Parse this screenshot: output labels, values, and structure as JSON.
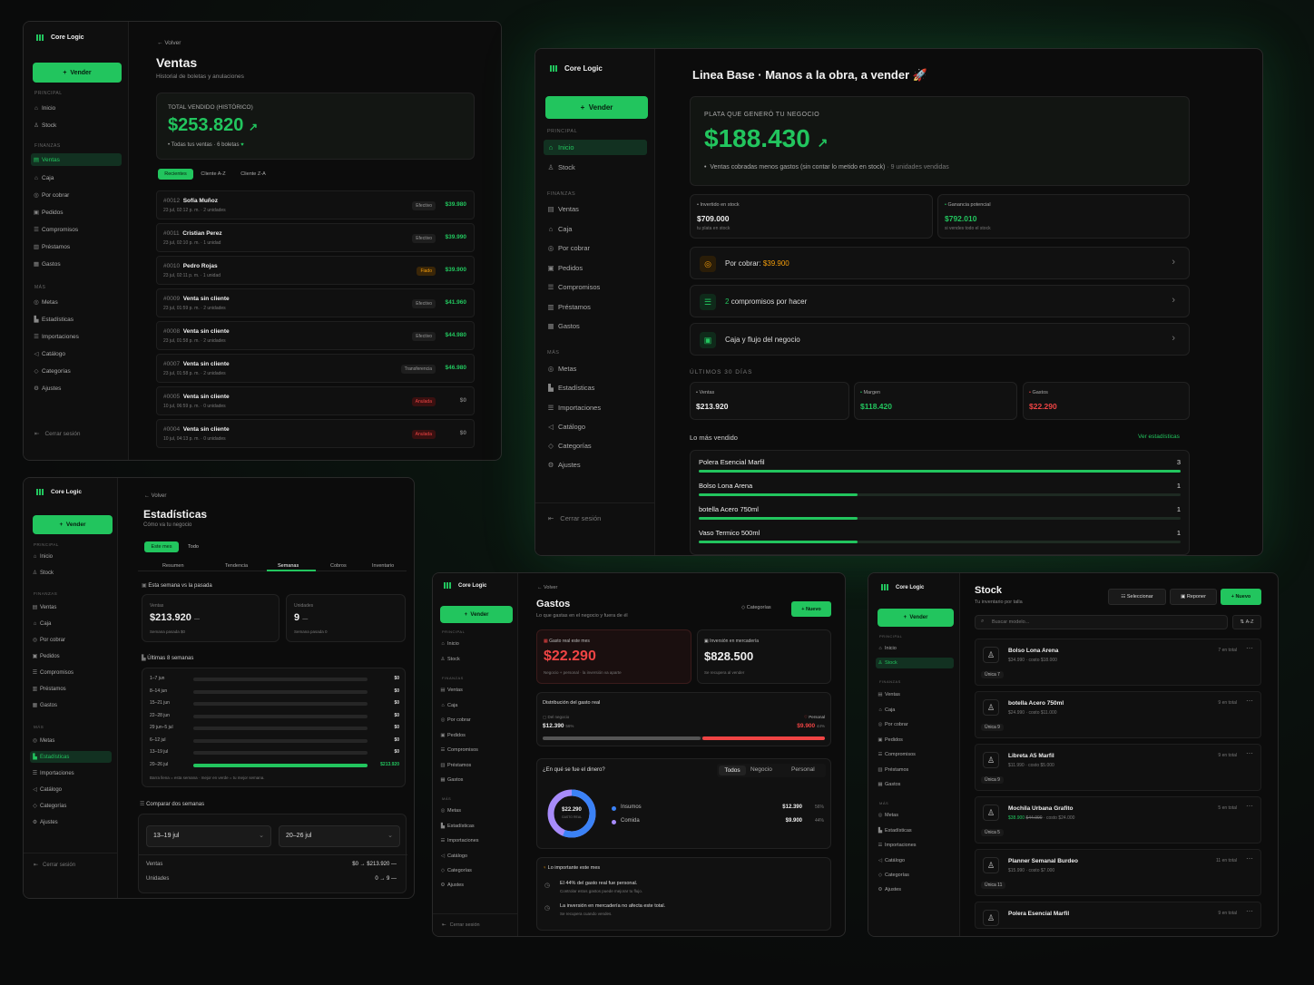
{
  "brand": "Core Logic",
  "vender": "Vender",
  "nav": {
    "principal": "PRINCIPAL",
    "inicio": "Inicio",
    "stock": "Stock",
    "finanzas": "FINANZAS",
    "ventas": "Ventas",
    "caja": "Caja",
    "por_cobrar": "Por cobrar",
    "pedidos": "Pedidos",
    "compromisos": "Compromisos",
    "prestamos": "Préstamos",
    "gastos": "Gastos",
    "mas": "MÁS",
    "metas": "Metas",
    "estadisticas": "Estadísticas",
    "importaciones": "Importaciones",
    "catalogo": "Catálogo",
    "categorias": "Categorías",
    "ajustes": "Ajustes",
    "logout": "Cerrar sesión"
  },
  "back": "Volver",
  "ventas": {
    "title": "Ventas",
    "subtitle": "Historial de boletas y anulaciones",
    "total_label": "TOTAL VENDIDO (HISTÓRICO)",
    "total": "$253.820",
    "total_note": "Todas tus ventas · 6 boletas",
    "filters": [
      "Recientes",
      "Cliente A-Z",
      "Cliente Z-A"
    ],
    "rows": [
      {
        "id": "#0012",
        "name": "Sofía Muñoz",
        "meta": "23 jul, 02:12 p. m. · 2 unidades",
        "tag": "Efectivo",
        "amount": "$39.980"
      },
      {
        "id": "#0011",
        "name": "Cristian Perez",
        "meta": "23 jul, 02:10 p. m. · 1 unidad",
        "tag": "Efectivo",
        "amount": "$39.990"
      },
      {
        "id": "#0010",
        "name": "Pedro Rojas",
        "meta": "23 jul, 02:11 p. m. · 1 unidad",
        "tag": "Fiado",
        "amount": "$39.900"
      },
      {
        "id": "#0009",
        "name": "Venta sin cliente",
        "meta": "23 jul, 01:59 p. m. · 2 unidades",
        "tag": "Efectivo",
        "amount": "$41.960"
      },
      {
        "id": "#0008",
        "name": "Venta sin cliente",
        "meta": "23 jul, 01:58 p. m. · 2 unidades",
        "tag": "Efectivo",
        "amount": "$44.980"
      },
      {
        "id": "#0007",
        "name": "Venta sin cliente",
        "meta": "23 jul, 01:58 p. m. · 2 unidades",
        "tag": "Transferencia",
        "amount": "$46.980"
      },
      {
        "id": "#0005",
        "name": "Venta sin cliente",
        "meta": "10 jul, 06:59 p. m. · 0 unidades",
        "tag": "Anulada",
        "amount": "$0"
      },
      {
        "id": "#0004",
        "name": "Venta sin cliente",
        "meta": "10 jul, 04:13 p. m. · 0 unidades",
        "tag": "Anulada",
        "amount": "$0"
      }
    ]
  },
  "inicio": {
    "title": "Linea Base · Manos a la obra, a vender 🚀",
    "plata_label": "PLATA QUE GENERÓ TU NEGOCIO",
    "plata": "$188.430",
    "plata_note": "Ventas cobradas menos gastos (sin contar lo metido en stock)",
    "plata_note2": "· 9 unidades vendidas",
    "invertido_label": "Invertido en stock",
    "invertido": "$709.000",
    "invertido_note": "tu plata en stock",
    "ganancia_label": "Ganancia potencial",
    "ganancia": "$792.010",
    "ganancia_note": "si vendes todo el stock",
    "porcobrar_label": "Por cobrar:",
    "porcobrar": "$39.900",
    "compromisos_n": "2",
    "compromisos": "compromisos por hacer",
    "caja": "Caja y flujo del negocio",
    "ultimos": "ÚLTIMOS 30 DÍAS",
    "k_ventas": "Ventas",
    "k_ventas_v": "$213.920",
    "k_margen": "Margen",
    "k_margen_v": "$118.420",
    "k_gastos": "Gastos",
    "k_gastos_v": "$22.290",
    "mas_vendido": "Lo más vendido",
    "ver": "Ver estadísticas",
    "top": [
      {
        "name": "Polera Esencial Marfil",
        "n": "3",
        "frac": 1
      },
      {
        "name": "Bolso Lona Arena",
        "n": "1",
        "frac": 0.33
      },
      {
        "name": "botella Acero 750ml",
        "n": "1",
        "frac": 0.33
      },
      {
        "name": "Vaso Termico 500ml",
        "n": "1",
        "frac": 0.33
      }
    ]
  },
  "estad": {
    "title": "Estadísticas",
    "subtitle": "Cómo va tu negocio",
    "range": [
      "Este mes",
      "Todo"
    ],
    "tabs": [
      "Resumen",
      "Tendencia",
      "Semanas",
      "Cobros",
      "Inventario"
    ],
    "sem_label": "Esta semana vs la pasada",
    "ventas_l": "Ventas",
    "ventas_v": "$213.920",
    "ventas_n": "Semana pasada $0",
    "unid_l": "Unidades",
    "unid_v": "9",
    "unid_n": "Semana pasada 0",
    "ult8": "Últimas 8 semanas",
    "weeks": [
      {
        "w": "1–7 jun",
        "v": "$0",
        "f": 0
      },
      {
        "w": "8–14 jun",
        "v": "$0",
        "f": 0
      },
      {
        "w": "15–21 jun",
        "v": "$0",
        "f": 0
      },
      {
        "w": "22–28 jun",
        "v": "$0",
        "f": 0
      },
      {
        "w": "29 jun–5 jul",
        "v": "$0",
        "f": 0
      },
      {
        "w": "6–12 jul",
        "v": "$0",
        "f": 0
      },
      {
        "w": "13–19 jul",
        "v": "$0",
        "f": 0
      },
      {
        "w": "20–26 jul",
        "v": "$213.920",
        "f": 1
      }
    ],
    "week_note": "Barra llena = esta semana · mejor en verde = tu mejor semana.",
    "comparar": "Comparar dos semanas",
    "sel_a": "13–19 jul",
    "sel_b": "20–26 jul",
    "c_ventas": "Ventas",
    "c_ventas_v": "$0 → $213.920 —",
    "c_unid": "Unidades",
    "c_unid_v": "0 → 9 —"
  },
  "gastos": {
    "title": "Gastos",
    "subtitle": "Lo que gastas en el negocio y fuera de él",
    "categorias": "Categorías",
    "nuevo": "+ Nuevo",
    "real_l": "Gasto real este mes",
    "real": "$22.290",
    "real_n": "Negocio + personal · la inversión va aparte",
    "merc_l": "Inversión en mercadería",
    "merc": "$828.500",
    "merc_n": "Se recupera al vender",
    "dist": "Distribución del gasto real",
    "neg_l": "Del negocio",
    "neg": "$12.390",
    "neg_p": "56%",
    "per_l": "Personal",
    "per": "$9.900",
    "per_p": "44%",
    "donde": "¿En qué se fue el dinero?",
    "ftabs": [
      "Todos",
      "Negocio",
      "Personal"
    ],
    "donut": "$22.290",
    "donut_sub": "GASTO REAL",
    "cats": [
      {
        "name": "Insumos",
        "v": "$12.390",
        "p": "56%"
      },
      {
        "name": "Comida",
        "v": "$9.900",
        "p": "44%"
      }
    ],
    "imp": "Lo importante este mes",
    "imp1": "El 44% del gasto real fue personal.",
    "imp1n": "Controlar estos gastos puede mejorar tu flujo.",
    "imp2": "La inversión en mercadería no afecta este total.",
    "imp2n": "Se recupera cuando vendes.",
    "colors": {
      "neg": "#22c55e",
      "per": "#ef4444",
      "donut_a": "#3b82f6",
      "donut_b": "#a78bfa"
    }
  },
  "stock": {
    "title": "Stock",
    "subtitle": "Tu inventario por talla",
    "seleccionar": "Seleccionar",
    "reponer": "Reponer",
    "nuevo": "+ Nuevo",
    "search": "Buscar modelo...",
    "sort": "A-Z",
    "items": [
      {
        "name": "Bolso Lona Arena",
        "price": "$34.990",
        "cost": "· costo $18.000",
        "total": "7 en total",
        "var": "Única 7"
      },
      {
        "name": "botella Acero 750ml",
        "price": "$24.990",
        "cost": "· costo $11.000",
        "total": "9 en total",
        "var": "Única 9"
      },
      {
        "name": "Libreta A5 Marfil",
        "price": "$11.990",
        "cost": "· costo $5.000",
        "total": "9 en total",
        "var": "Única 9"
      },
      {
        "name": "Mochila Urbana Grafito",
        "price": "$38.900",
        "old": "$44.990",
        "cost": "· costo $24.000",
        "total": "5 en total",
        "var": "Única 5"
      },
      {
        "name": "Planner Semanal Burdeo",
        "price": "$15.990",
        "cost": "· costo $7.000",
        "total": "11 en total",
        "var": "Única 11"
      },
      {
        "name": "Polera Esencial Marfil",
        "price": "",
        "cost": "",
        "total": "9 en total",
        "var": ""
      }
    ]
  }
}
